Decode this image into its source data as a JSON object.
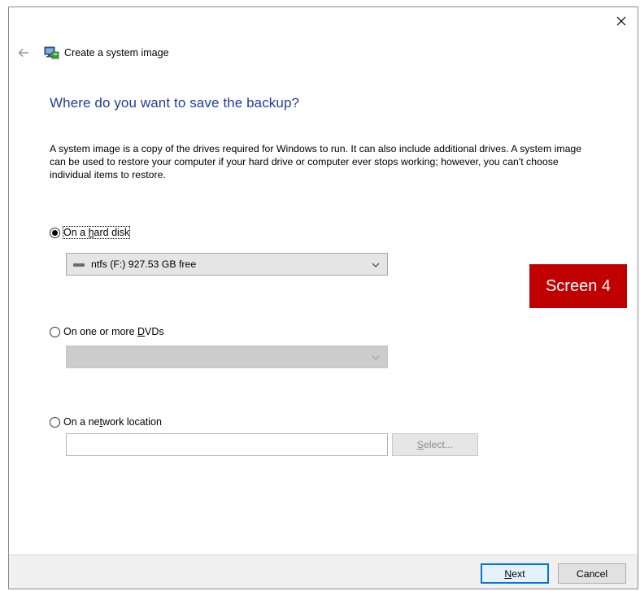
{
  "header": {
    "title": "Create a system image"
  },
  "page": {
    "heading": "Where do you want to save the backup?",
    "description": "A system image is a copy of the drives required for Windows to run. It can also include additional drives. A system image can be used to restore your computer if your hard drive or computer ever stops working; however, you can't choose individual items to restore."
  },
  "options": {
    "hard_disk": {
      "pre": "On a ",
      "key": "h",
      "post": "ard disk",
      "selected": true
    },
    "hard_disk_combo": {
      "value": "ntfs (F:)  927.53 GB free"
    },
    "dvd": {
      "pre": "On one or more ",
      "key": "D",
      "post": "VDs",
      "selected": false
    },
    "dvd_combo": {
      "value": ""
    },
    "network": {
      "pre": "On a ne",
      "key": "t",
      "post": "work location",
      "selected": false
    },
    "network_path": {
      "value": "",
      "placeholder": ""
    },
    "select_button": {
      "key": "S",
      "post": "elect..."
    }
  },
  "badge": {
    "text": "Screen 4"
  },
  "footer": {
    "next": {
      "key": "N",
      "post": "ext"
    },
    "cancel": {
      "label": "Cancel"
    }
  },
  "colors": {
    "heading": "#1e3f9a",
    "badge": "#c00000",
    "focus_border": "#0078d7"
  },
  "icons": {
    "close": "close-icon",
    "back": "back-arrow-icon",
    "app": "system-image-icon",
    "drive": "drive-icon",
    "dropdown": "chevron-down-icon"
  }
}
